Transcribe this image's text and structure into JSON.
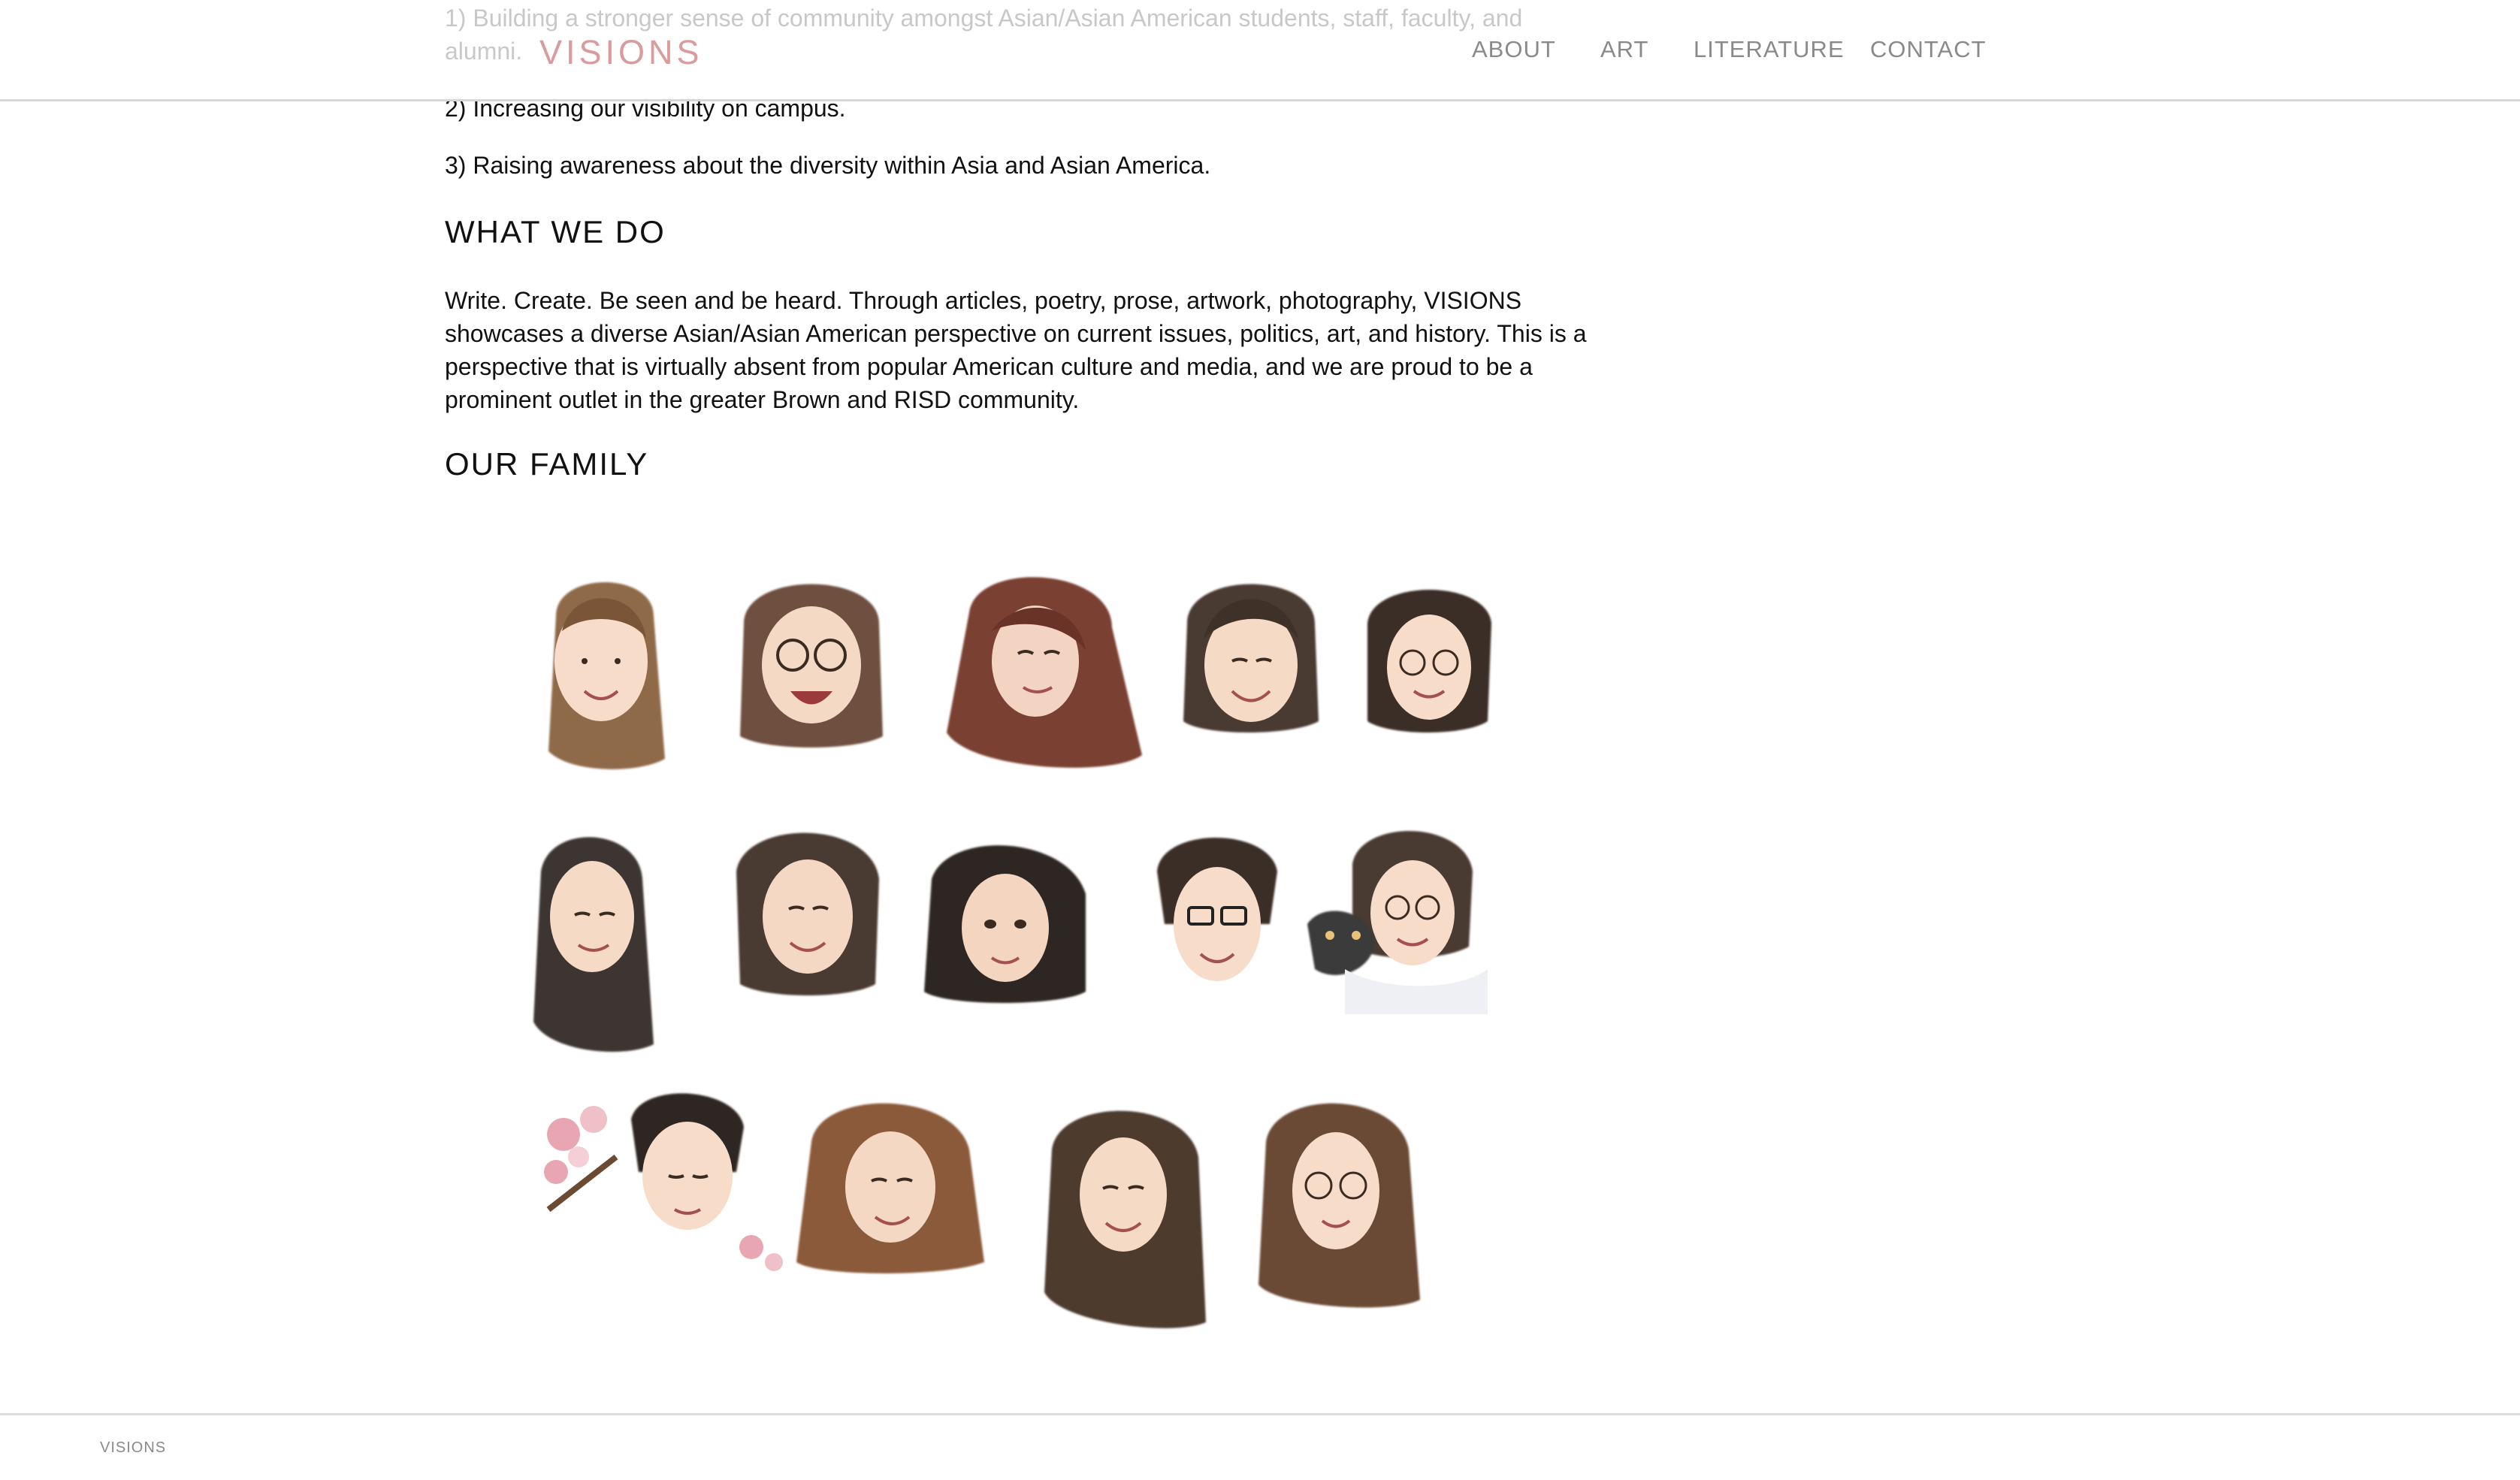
{
  "header": {
    "logo": "VISIONS",
    "nav": {
      "about": "ABOUT",
      "art": "ART",
      "literature": "LITERATURE",
      "contact": "CONTACT"
    },
    "faded_text": {
      "line1": "1) Building a stronger sense of community amongst Asian/Asian American students, staff, faculty, and",
      "line2": "alumni."
    }
  },
  "main": {
    "goal2": "2) Increasing our visibility on campus.",
    "goal3": "3) Raising awareness about the diversity within Asia and Asian America.",
    "what_we_do": {
      "heading": "WHAT WE DO",
      "body": "Write. Create. Be seen and be heard. Through articles, poetry, prose, artwork, photography, VISIONS showcases a diverse Asian/Asian American perspective on current issues, politics, art, and history. This is a perspective that is virtually absent from popular American culture and media, and we are proud to be a prominent outlet in the greater Brown and RISD community."
    },
    "our_family": {
      "heading": "OUR FAMILY"
    }
  },
  "footer": {
    "text": "VISIONS"
  },
  "colors": {
    "logo": "#d99b9b",
    "nav": "#8a8a8a",
    "hair_dark": "#3d2f26",
    "hair_brown": "#6b4a33",
    "hair_light": "#9b7250",
    "skin": "#f6dcc9"
  }
}
